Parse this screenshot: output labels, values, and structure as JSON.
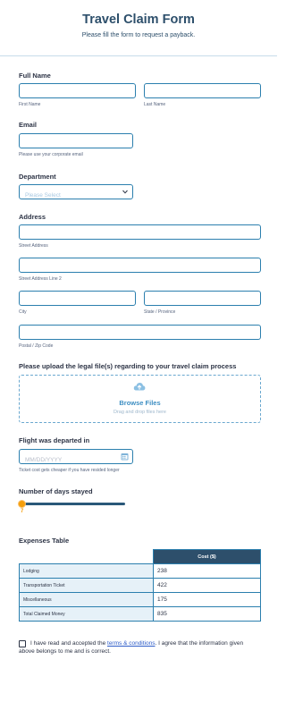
{
  "header": {
    "title": "Travel Claim Form",
    "subtitle": "Please fill the form to request a payback."
  },
  "full_name": {
    "label": "Full Name",
    "first_sublabel": "First Name",
    "last_sublabel": "Last Name"
  },
  "email": {
    "label": "Email",
    "sublabel": "Please use your corporate email"
  },
  "department": {
    "label": "Department",
    "selected": "Please Select"
  },
  "address": {
    "label": "Address",
    "street_sublabel": "Street Address",
    "street2_sublabel": "Street Address Line 2",
    "city_sublabel": "City",
    "state_sublabel": "State / Province",
    "zip_sublabel": "Postal / Zip Code"
  },
  "upload": {
    "label": "Please upload the legal file(s) regarding to your travel claim process",
    "browse": "Browse Files",
    "hint": "Drag and drop files here",
    "icon": "cloud-upload-icon"
  },
  "flight": {
    "label": "Flight was departed in",
    "placeholder": "MM/DD/YYYY",
    "sublabel": "Ticket cost gets cheaper if you have resided longer",
    "icon": "calendar-icon"
  },
  "days": {
    "label": "Number of days stayed",
    "value": "7"
  },
  "expenses": {
    "label": "Expenses Table",
    "column": "Cost ($)",
    "rows": [
      {
        "name": "Lodging",
        "value": "238"
      },
      {
        "name": "Transportation Ticket",
        "value": "422"
      },
      {
        "name": "Miscellaneous",
        "value": "175"
      },
      {
        "name": "Total Claimed Money",
        "value": "835"
      }
    ]
  },
  "terms": {
    "before": "I have read and accepted the ",
    "link": "terms & conditions",
    "after": ". I agree that the information given above belongs to me and is correct."
  },
  "colors": {
    "heading": "#2d4f6b",
    "accent": "#2b7fae",
    "slider_knob": "#f59e0b"
  }
}
